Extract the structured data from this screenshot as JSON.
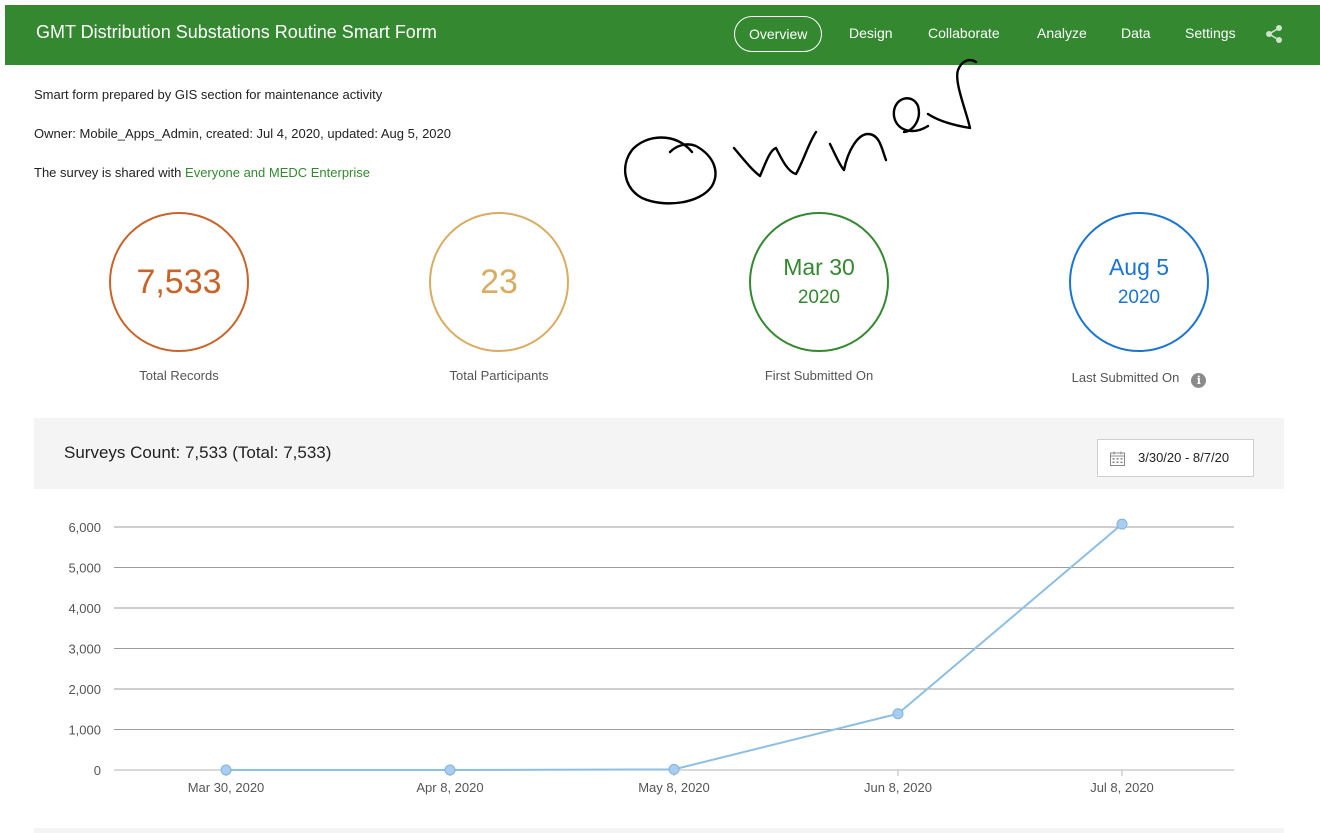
{
  "header": {
    "title": "GMT Distribution Substations Routine Smart Form",
    "nav": [
      {
        "label": "Overview",
        "active": true
      },
      {
        "label": "Design"
      },
      {
        "label": "Collaborate"
      },
      {
        "label": "Analyze"
      },
      {
        "label": "Data"
      },
      {
        "label": "Settings"
      }
    ],
    "share_icon": "share-icon"
  },
  "info": {
    "description": "Smart form prepared by GIS section for maintenance activity",
    "owner_line": "Owner: Mobile_Apps_Admin, created: Jul 4, 2020, updated: Aug 5, 2020",
    "shared_prefix": "The survey is shared with",
    "shared_with": "Everyone and MEDC Enterprise"
  },
  "annotation": {
    "handwritten_text": "Owner"
  },
  "stats": {
    "total_records": {
      "value": "7,533",
      "label": "Total Records",
      "color": "#c8642a"
    },
    "total_participants": {
      "value": "23",
      "label": "Total Participants",
      "color": "#d9ac62"
    },
    "first_submitted": {
      "date": "Mar 30",
      "year": "2020",
      "label": "First Submitted On",
      "color": "#338830"
    },
    "last_submitted": {
      "date": "Aug 5",
      "year": "2020",
      "label": "Last Submitted On",
      "color": "#1b73d3"
    }
  },
  "chart_panel": {
    "title": "Surveys Count: 7,533 (Total: 7,533)",
    "date_range": "3/30/20 - 8/7/20",
    "calendar_icon": "calendar-icon"
  },
  "chart_data": {
    "type": "line",
    "categories": [
      "Mar 30, 2020",
      "Apr 8, 2020",
      "May 8, 2020",
      "Jun 8, 2020",
      "Jul 8, 2020"
    ],
    "series": [
      {
        "values": [
          0,
          0,
          15,
          1390,
          6070
        ],
        "color": "#8cbfe6"
      }
    ],
    "y_ticks": [
      "0",
      "1,000",
      "2,000",
      "3,000",
      "4,000",
      "5,000",
      "6,000"
    ],
    "ylim": [
      0,
      6000
    ],
    "grid": true
  }
}
